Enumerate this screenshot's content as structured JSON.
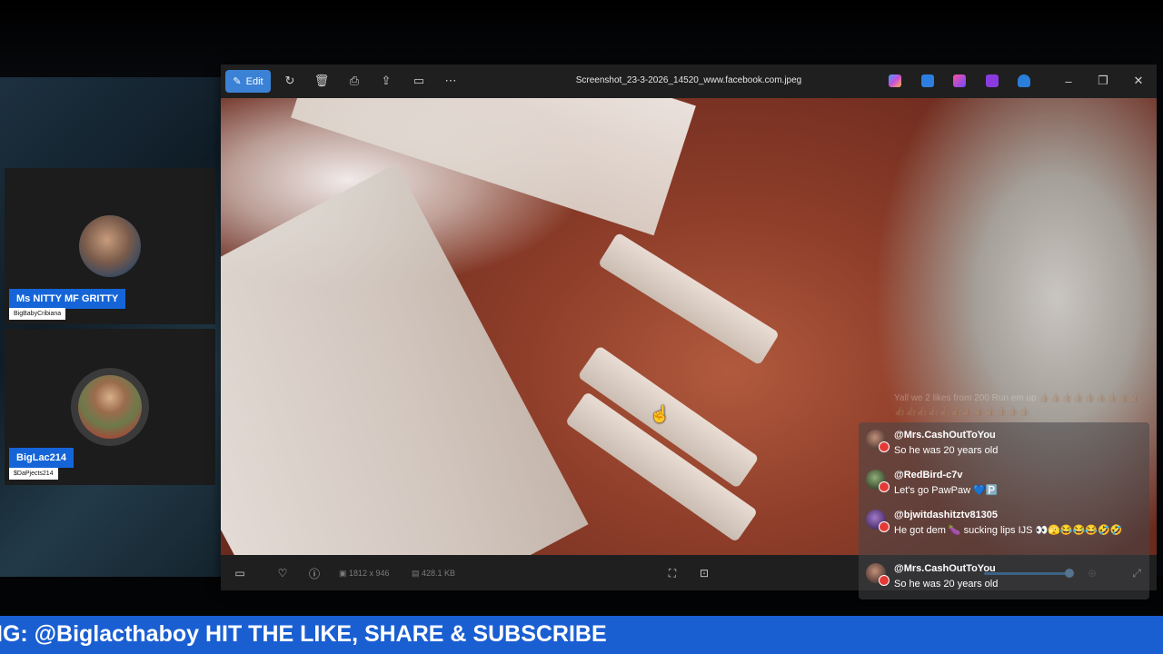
{
  "viewer": {
    "edit_label": "Edit",
    "filename": "Screenshot_23-3-2026_14520_www.facebook.com.jpeg",
    "dimensions": "1812 x 946",
    "file_size": "428.1 KB"
  },
  "participants": [
    {
      "name": "Ms NITTY MF GRITTY",
      "handle": "BigBabyCribiana"
    },
    {
      "name": "BigLac214",
      "handle": "$DaPjects214"
    }
  ],
  "chat": {
    "faded_message": "Yall we 2 likes from 200 Run em up 👍🏽👍🏽👍🏽👍🏽👍🏽👍🏽👍🏽👍🏽👍🏽👍🏽👍🏽👍🏽👍🏽👍🏽👍🏽👍🏽👍🏽👍🏽👍🏽👍🏽👍🏽",
    "messages": [
      {
        "user": "@Mrs.CashOutToYou",
        "text": "So he was 20 years old"
      },
      {
        "user": "@RedBird-c7v",
        "text": "Let's go PawPaw 💙🅿️"
      },
      {
        "user": "@bjwitdashitztv81305",
        "text": "He got dem 🍆 sucking lips IJS 👀🫣😂😂😂🤣🤣"
      },
      {
        "user": "@Mrs.CashOutToYou",
        "text": "So he was 20 years old"
      }
    ]
  },
  "ticker": {
    "text": "IG: @Biglacthaboy HIT THE LIKE, SHARE & SUBSCRIBE"
  },
  "icons": {
    "toolbar": [
      "edit-icon",
      "rotate-icon",
      "delete-icon",
      "print-icon",
      "share-icon",
      "slideshow-icon",
      "more-icon"
    ],
    "apps": [
      "copilot-icon",
      "designer-icon",
      "clipchamp-icon",
      "video-editor-icon",
      "onedrive-icon"
    ],
    "bottom": [
      "filmstrip-icon",
      "favorite-icon",
      "info-icon",
      "fit-icon",
      "actual-size-icon",
      "zoom-in-icon",
      "fullscreen-icon"
    ]
  }
}
